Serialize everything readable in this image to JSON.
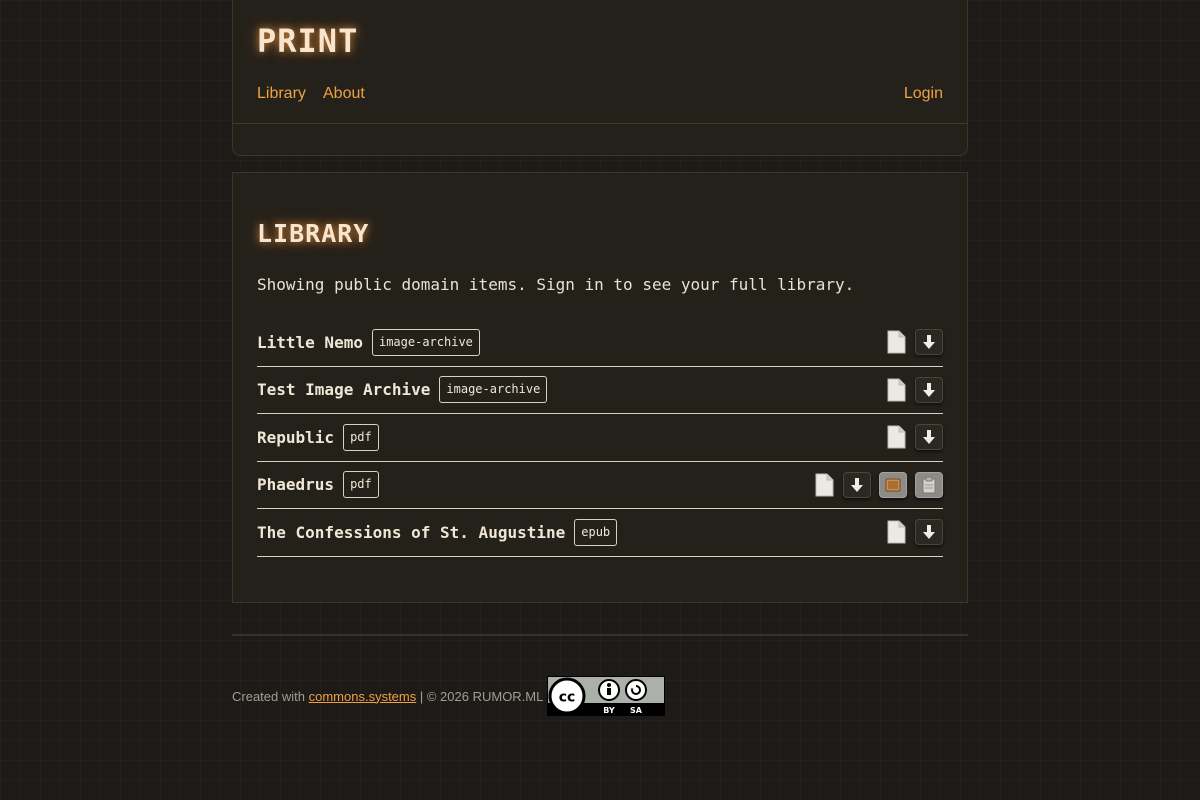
{
  "site": {
    "title": "PRINT"
  },
  "nav": {
    "library": "Library",
    "about": "About",
    "login": "Login"
  },
  "library": {
    "heading": "LIBRARY",
    "notice": "Showing public domain items. Sign in to see your full library.",
    "items": [
      {
        "title": "Little Nemo",
        "type": "image-archive",
        "actions": [
          "file-icon",
          "download-icon"
        ]
      },
      {
        "title": "Test Image Archive",
        "type": "image-archive",
        "actions": [
          "file-icon",
          "download-icon"
        ]
      },
      {
        "title": "Republic",
        "type": "pdf",
        "actions": [
          "file-icon",
          "download-icon"
        ]
      },
      {
        "title": "Phaedrus",
        "type": "pdf",
        "actions": [
          "file-icon",
          "download-icon",
          "scroll-icon",
          "clipboard-icon"
        ]
      },
      {
        "title": "The Confessions of St. Augustine",
        "type": "epub",
        "actions": [
          "file-icon",
          "download-icon"
        ]
      }
    ]
  },
  "footer": {
    "created_with": "Created with",
    "link": "commons.systems",
    "copyright": "| © 2026 RUMOR.ML",
    "license_badge": {
      "left": "BY",
      "right": "SA"
    }
  },
  "colors": {
    "background": "#1d1a17",
    "panel": "#24211b",
    "accent": "#eea144",
    "title_glow": "#f0963c"
  }
}
